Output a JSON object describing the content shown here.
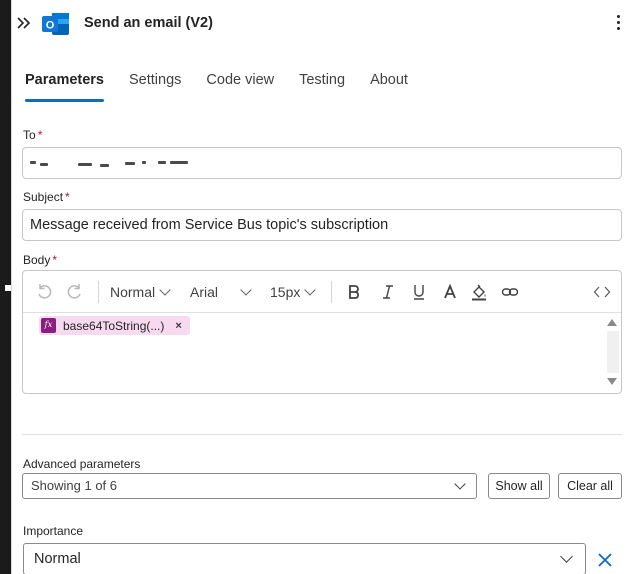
{
  "header": {
    "title": "Send an email (V2)",
    "logo_letter": "O"
  },
  "tabs": [
    {
      "label": "Parameters",
      "active": true
    },
    {
      "label": "Settings",
      "active": false
    },
    {
      "label": "Code view",
      "active": false
    },
    {
      "label": "Testing",
      "active": false
    },
    {
      "label": "About",
      "active": false
    }
  ],
  "to": {
    "label": "To",
    "required_mark": "*"
  },
  "subject": {
    "label": "Subject",
    "required_mark": "*",
    "value": "Message received from Service Bus topic's subscription"
  },
  "body": {
    "label": "Body",
    "required_mark": "*",
    "toolbar": {
      "format": "Normal",
      "font": "Arial",
      "size": "15px"
    },
    "token": {
      "icon": "fx",
      "label": "base64ToString(...)",
      "remove": "×"
    }
  },
  "advanced": {
    "label": "Advanced parameters",
    "selected": "Showing 1 of 6",
    "show_all": "Show all",
    "clear_all": "Clear all"
  },
  "importance": {
    "label": "Importance",
    "value": "Normal"
  },
  "colors": {
    "accent": "#0f6cbd",
    "required": "#c50f1f",
    "token_bg": "#f7d9f0",
    "token_icon": "#8a1f80"
  }
}
